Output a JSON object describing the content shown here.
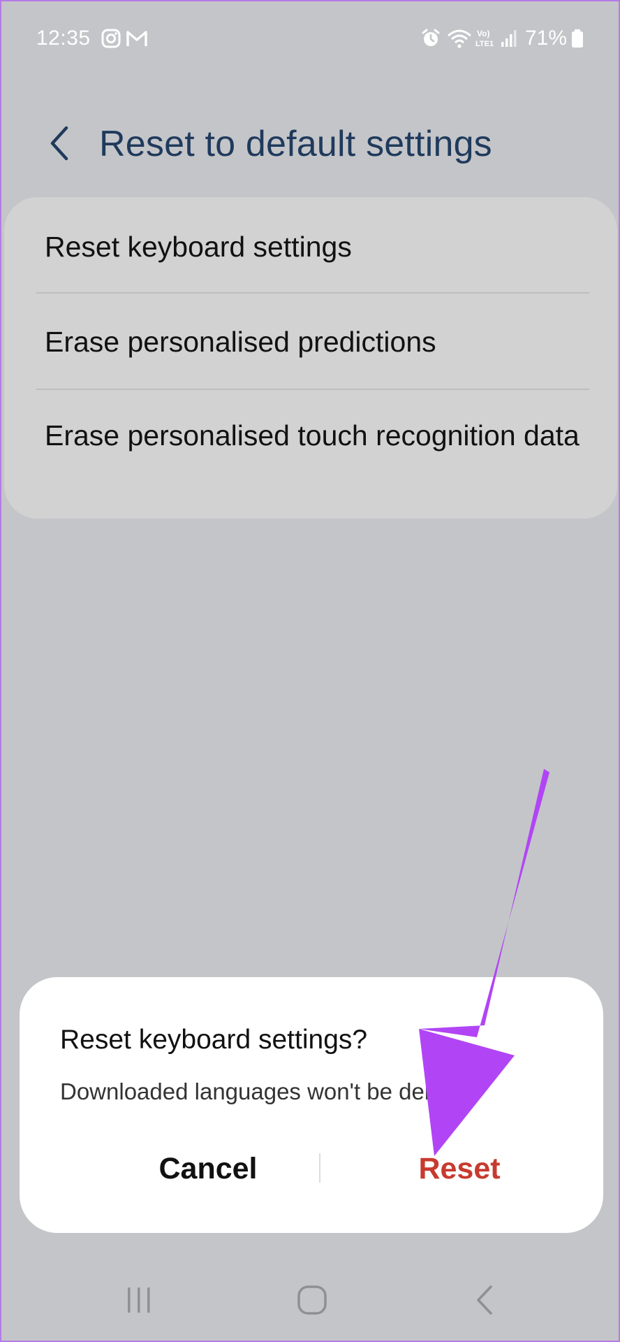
{
  "status_bar": {
    "time": "12:35",
    "battery": "71%",
    "left_icons": [
      "instagram-icon",
      "gmail-icon"
    ],
    "right_icons": [
      "alarm-icon",
      "wifi-icon",
      "volte-icon",
      "signal-icon",
      "battery-icon"
    ],
    "volte_label_top": "Vo)",
    "volte_label_bottom": "LTE1"
  },
  "header": {
    "title": "Reset to default settings",
    "back_icon": "chevron-left-icon"
  },
  "list": {
    "items": [
      {
        "label": "Reset keyboard settings"
      },
      {
        "label": "Erase personalised predictions"
      },
      {
        "label": "Erase personalised touch recognition data"
      }
    ]
  },
  "dialog": {
    "title": "Reset keyboard settings?",
    "message": "Downloaded languages won't be deleted.",
    "cancel_label": "Cancel",
    "reset_label": "Reset",
    "reset_color": "#c73a2e"
  },
  "nav_bar": {
    "items": [
      "recents-icon",
      "home-icon",
      "back-icon"
    ]
  },
  "colors": {
    "background": "#c4c5c8",
    "card": "#d2d2d3",
    "title": "#1f3a5c",
    "arrow": "#b145f5"
  }
}
